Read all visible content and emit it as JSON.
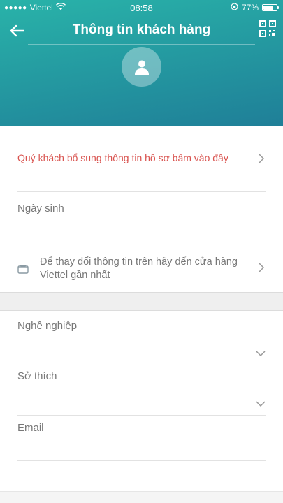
{
  "status_bar": {
    "carrier": "Viettel",
    "time": "08:58",
    "battery_percent": "77%",
    "battery_level": 0.77
  },
  "header": {
    "title": "Thông tin khách hàng",
    "back_icon": "arrow-left-icon",
    "qr_icon": "qr-code-icon",
    "avatar_icon": "user-icon",
    "gradient_start": "#29b3a9",
    "gradient_end": "#1f7f98"
  },
  "profile_prompt": {
    "text": "Quý khách bổ sung thông tin hồ sơ bấm vào đây",
    "color": "#d9534f"
  },
  "birthday": {
    "label": "Ngày sinh"
  },
  "store_notice": {
    "text": "Để thay đổi thông tin trên hãy đến cửa hàng Viettel gần nhất",
    "icon": "store-icon"
  },
  "occupation": {
    "label": "Nghề nghiệp"
  },
  "hobbies": {
    "label": "Sở thích"
  },
  "email": {
    "label": "Email"
  }
}
